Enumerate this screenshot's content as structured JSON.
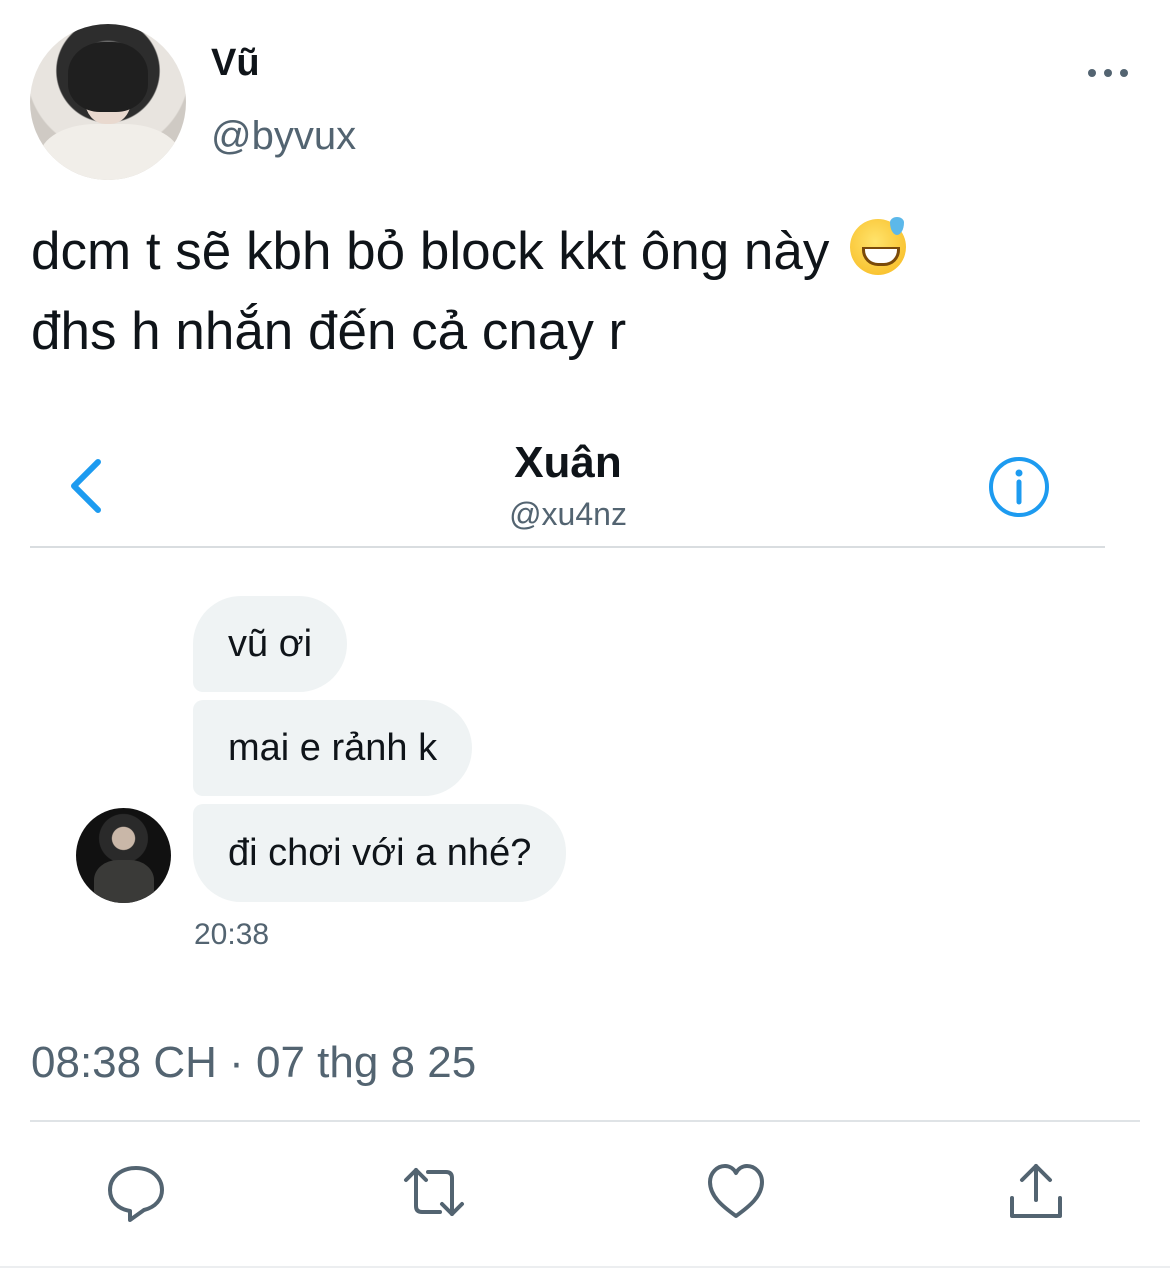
{
  "tweet": {
    "display_name": "Vũ",
    "handle": "@byvux",
    "text_line1": "dcm t sẽ kbh bỏ block kkt ông này",
    "emoji": "grinning-face-with-sweat",
    "text_line2": "đhs h nhắn đến cả cnay r",
    "timestamp": "08:38 CH · 07 thg 8 25"
  },
  "dm_screenshot": {
    "contact_name": "Xuân",
    "contact_handle": "@xu4nz",
    "messages": [
      {
        "text": "vũ ơi"
      },
      {
        "text": "mai e rảnh k"
      },
      {
        "text": "đi chơi với a nhé?"
      }
    ],
    "message_time": "20:38"
  },
  "icons": {
    "more": "more-icon",
    "back": "chevron-left-icon",
    "info": "info-icon",
    "reply": "reply-icon",
    "retweet": "retweet-icon",
    "like": "heart-icon",
    "share": "share-icon"
  },
  "colors": {
    "accent": "#1d9bf0",
    "text": "#0f1419",
    "secondary": "#536471",
    "bubble": "#eff3f4"
  }
}
